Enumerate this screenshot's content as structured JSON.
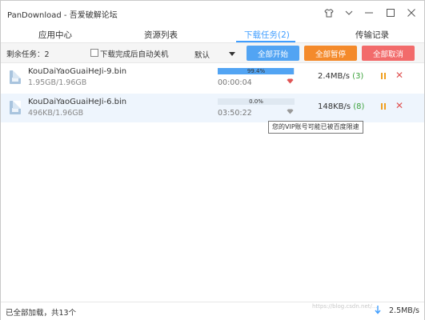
{
  "window": {
    "title": "PanDownload - 吾爱破解论坛",
    "icons": [
      "shirt-icon",
      "chevron-down-icon",
      "minimize-icon",
      "maximize-icon",
      "close-icon"
    ]
  },
  "tabs": [
    {
      "label": "应用中心",
      "active": false
    },
    {
      "label": "资源列表",
      "active": false
    },
    {
      "label": "下载任务(2)",
      "active": true
    },
    {
      "label": "传输记录",
      "active": false
    }
  ],
  "toolbar": {
    "remaining_label": "剩余任务：2",
    "auto_shutdown_label": "下载完成后自动关机",
    "auto_shutdown_checked": false,
    "sort_value": "默认",
    "start_all": "全部开始",
    "pause_all": "全部暂停",
    "cancel_all": "全部取消"
  },
  "tasks": [
    {
      "name": "KouDaiYaoGuaiHeJi-9.bin",
      "size": "1.95GB/1.96GB",
      "progress_pct": 99.4,
      "progress_label": "99.4%",
      "time": "00:00:04",
      "speed": "2.4MB/s",
      "connections": "(3)",
      "vip_icon_color": "#e05555"
    },
    {
      "name": "KouDaiYaoGuaiHeJi-6.bin",
      "size": "496KB/1.96GB",
      "progress_pct": 0.0,
      "progress_label": "0.0%",
      "time": "03:50:22",
      "speed": "148KB/s",
      "connections": "(8)",
      "vip_icon_color": "#999999"
    }
  ],
  "tooltip": "您的VIP账号可能已被百度限速",
  "status": {
    "text": "已全部加载，共13个",
    "total_speed": "2.5MB/s"
  },
  "watermark": "https://blog.csdn.net/..."
}
